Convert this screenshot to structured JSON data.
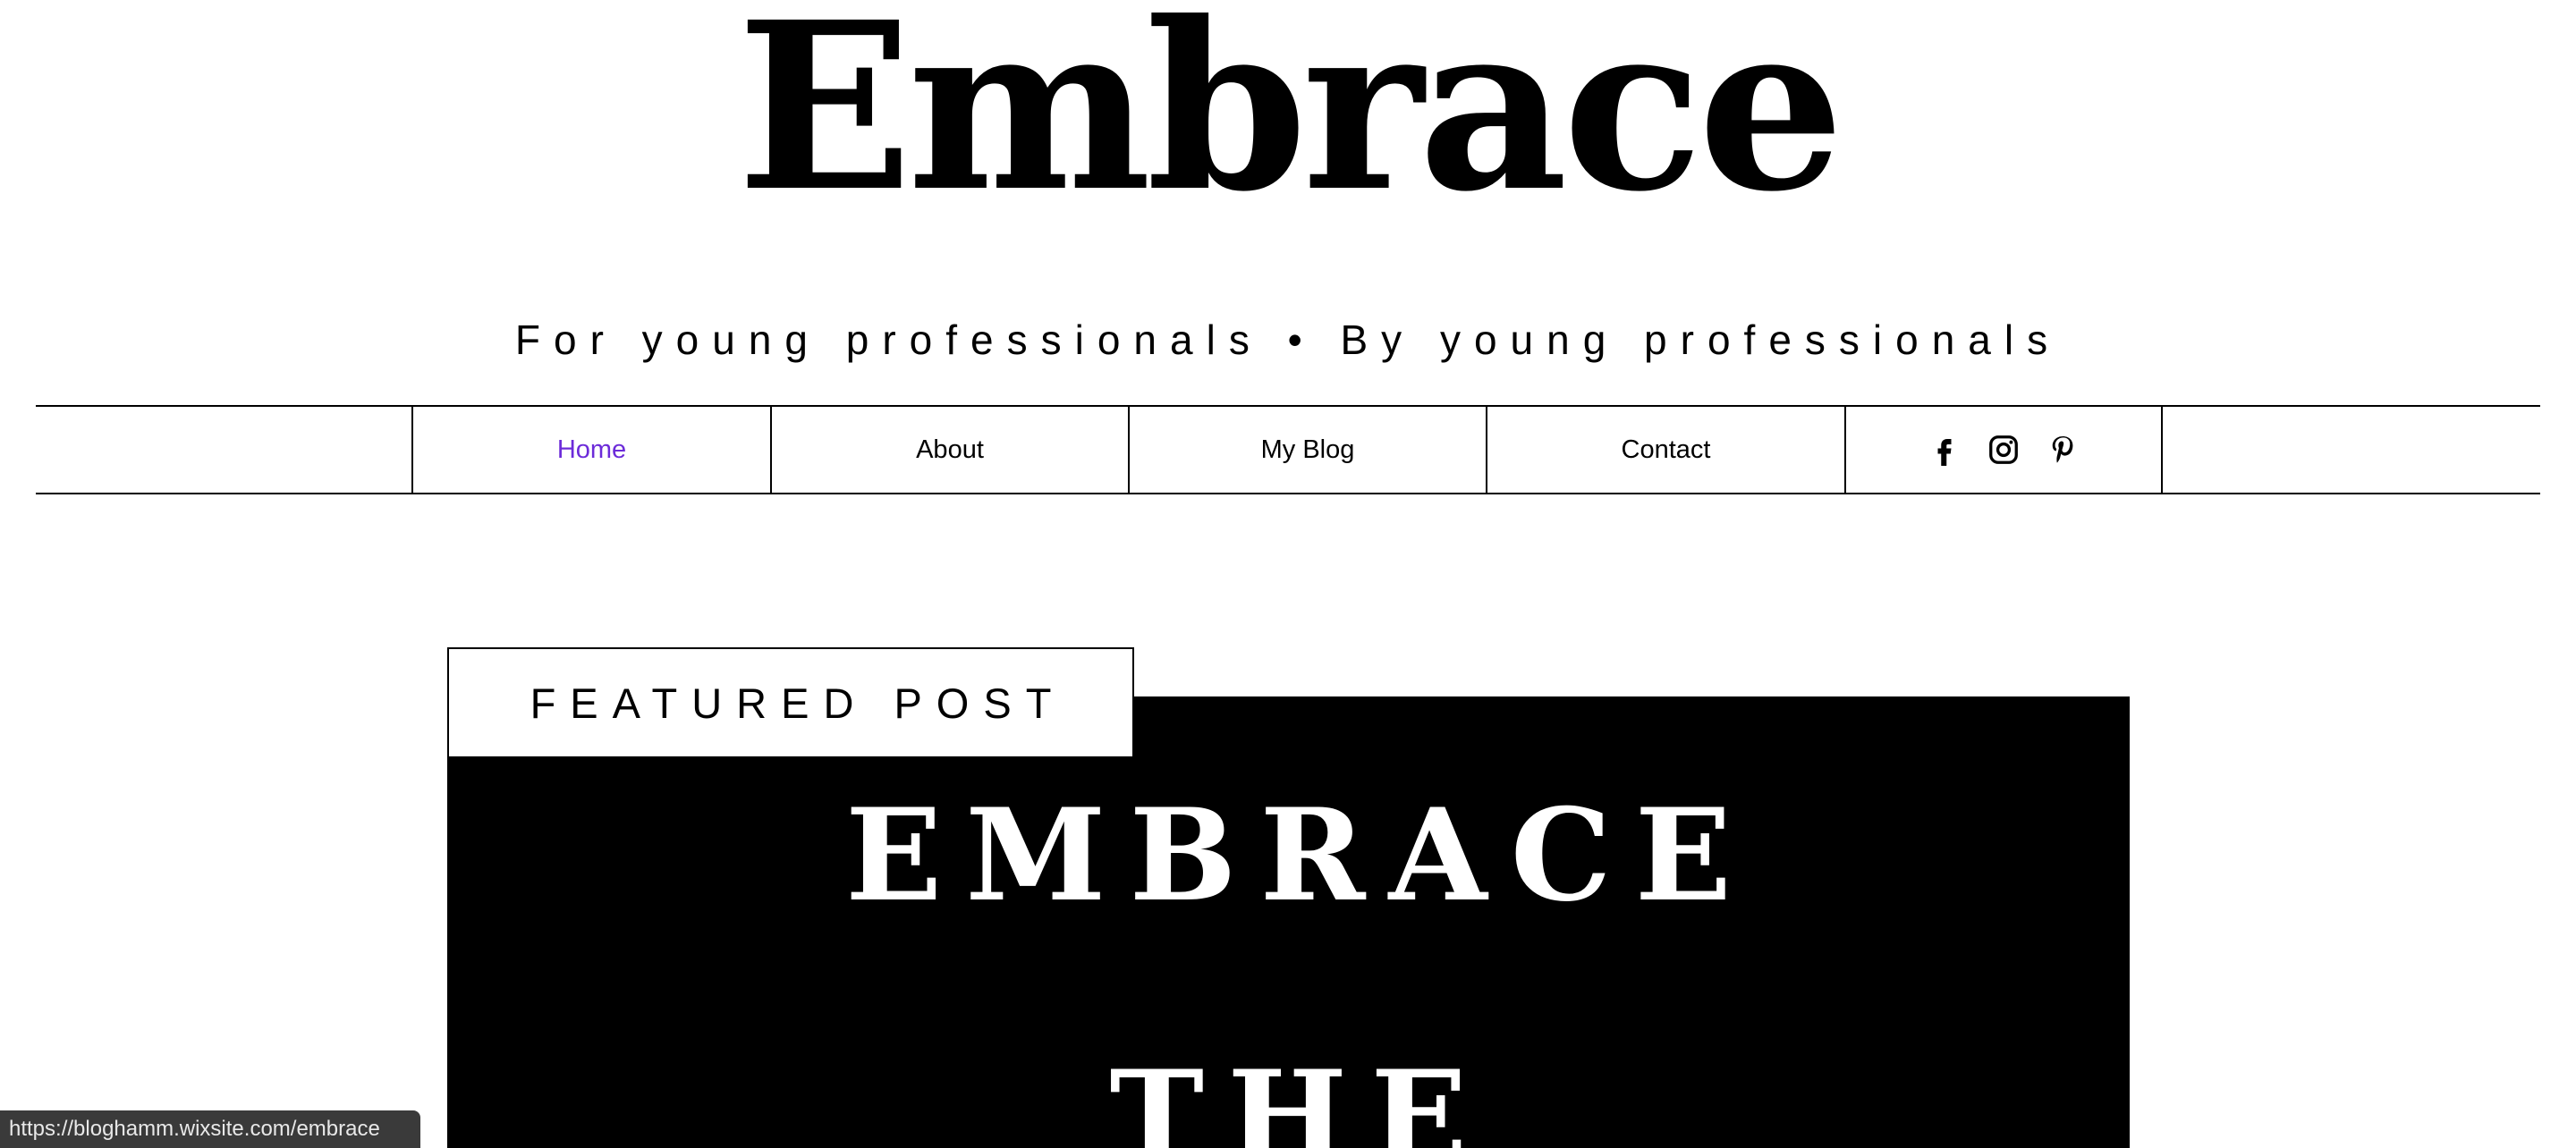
{
  "site": {
    "title": "Embrace",
    "tagline": "For young professionals • By young professionals"
  },
  "nav": {
    "items": [
      {
        "label": "Home",
        "active": true
      },
      {
        "label": "About",
        "active": false
      },
      {
        "label": "My Blog",
        "active": false
      },
      {
        "label": "Contact",
        "active": false
      }
    ],
    "active_color": "#6c2bd9",
    "social": [
      "facebook-icon",
      "instagram-icon",
      "pinterest-icon"
    ]
  },
  "featured": {
    "label": "FEATURED POST",
    "image_text_line1": "EMBRACE",
    "image_text_line2": "THE"
  },
  "status_bar": {
    "url": "https://bloghamm.wixsite.com/embrace"
  }
}
